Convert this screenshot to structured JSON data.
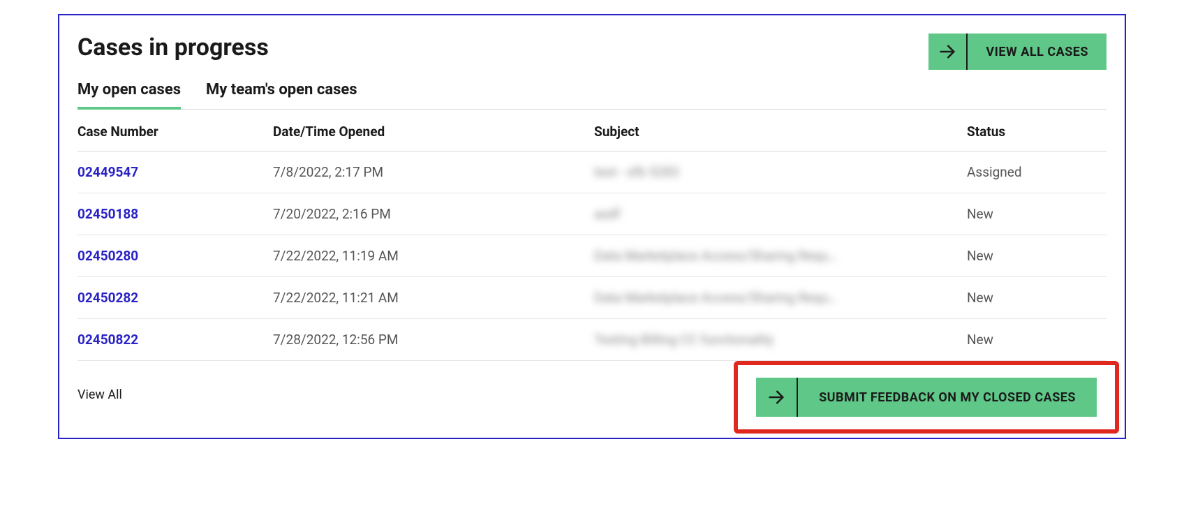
{
  "header": {
    "title": "Cases in progress",
    "view_all_button": "VIEW ALL CASES"
  },
  "tabs": {
    "items": [
      {
        "label": "My open cases",
        "active": true
      },
      {
        "label": "My team's open cases",
        "active": false
      }
    ]
  },
  "table": {
    "columns": {
      "case_number": "Case Number",
      "date_opened": "Date/Time Opened",
      "subject": "Subject",
      "status": "Status"
    },
    "rows": [
      {
        "case_number": "02449547",
        "date_opened": "7/8/2022, 2:17 PM",
        "subject": "test - sfb 5283",
        "status": "Assigned"
      },
      {
        "case_number": "02450188",
        "date_opened": "7/20/2022, 2:16 PM",
        "subject": "asdf",
        "status": "New"
      },
      {
        "case_number": "02450280",
        "date_opened": "7/22/2022, 11:19 AM",
        "subject": "Data Marketplace Access/Sharing Requ…",
        "status": "New"
      },
      {
        "case_number": "02450282",
        "date_opened": "7/22/2022, 11:21 AM",
        "subject": "Data Marketplace Access/Sharing Requ…",
        "status": "New"
      },
      {
        "case_number": "02450822",
        "date_opened": "7/28/2022, 12:56 PM",
        "subject": "Testing Billing CC functionality",
        "status": "New"
      }
    ]
  },
  "footer": {
    "view_all_link": "View All",
    "submit_feedback_button": "SUBMIT FEEDBACK ON MY CLOSED CASES"
  }
}
